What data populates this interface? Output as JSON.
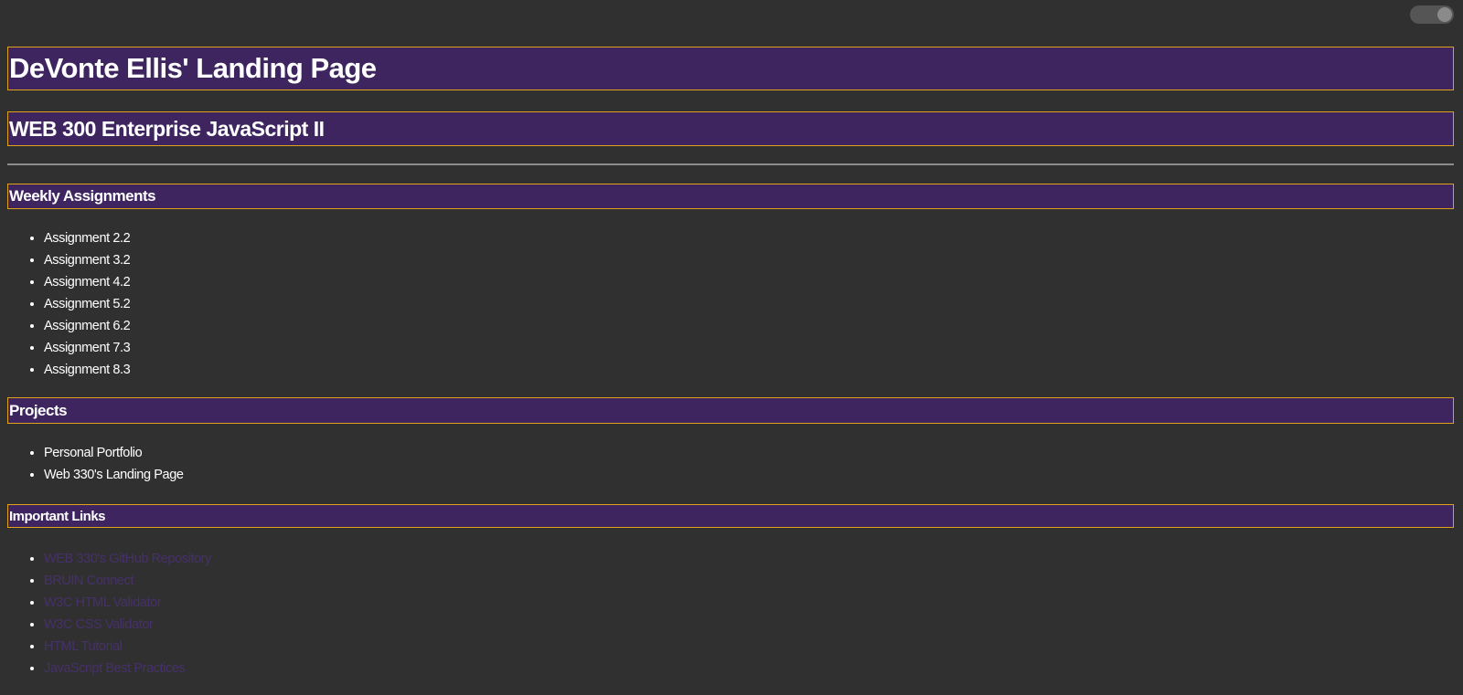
{
  "header": {
    "title": "DeVonte Ellis' Landing Page",
    "course": "WEB 300 Enterprise JavaScript II"
  },
  "theme_toggle": {
    "state": "on"
  },
  "sections": {
    "weekly": {
      "heading": "Weekly Assignments",
      "items": [
        "Assignment 2.2",
        "Assignment 3.2",
        "Assignment 4.2",
        "Assignment 5.2",
        "Assignment 6.2",
        "Assignment 7.3",
        "Assignment 8.3"
      ]
    },
    "projects": {
      "heading": "Projects",
      "items": [
        "Personal Portfolio",
        "Web 330's Landing Page"
      ]
    },
    "links": {
      "heading": "Important Links",
      "items": [
        "WEB 330's GitHub Repository",
        "BRUIN Connect",
        "W3C HTML Validator",
        "W3C CSS Validator",
        "HTML Tutorial",
        "JavaScript Best Practices"
      ]
    }
  },
  "colors": {
    "background": "#303030",
    "header_bg": "#3e2560",
    "header_border": "#e0a21a",
    "link": "#46306a"
  }
}
